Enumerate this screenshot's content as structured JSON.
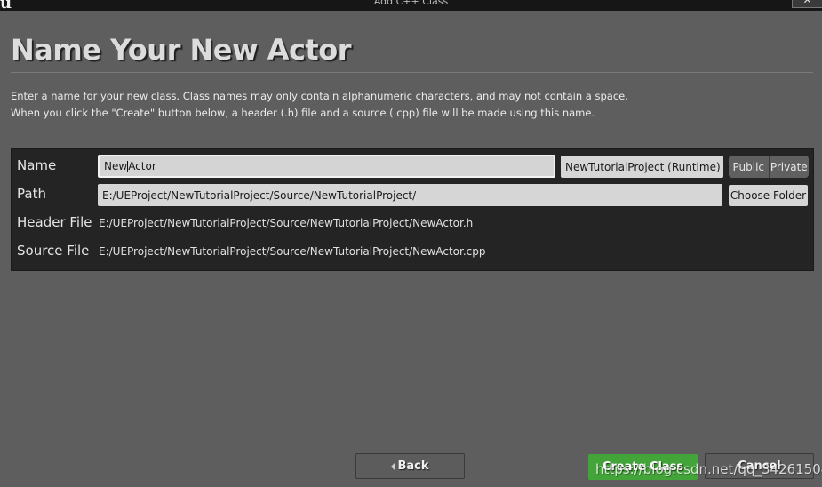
{
  "window": {
    "logo": "u",
    "title": "Add C++ Class",
    "close_label": "✕"
  },
  "page": {
    "heading": "Name Your New Actor",
    "description_line1": "Enter a name for your new class. Class names may only contain alphanumeric characters, and may not contain a space.",
    "description_line2": "When you click the \"Create\" button below, a header (.h) file and a source (.cpp) file will be made using this name."
  },
  "form": {
    "name": {
      "label": "Name",
      "value_before_caret": "New",
      "value_after_caret": "Actor"
    },
    "module_dropdown": {
      "value": "NewTutorialProject (Runtime)"
    },
    "visibility": {
      "options": [
        "Public",
        "Private"
      ]
    },
    "path": {
      "label": "Path",
      "value": "E:/UEProject/NewTutorialProject/Source/NewTutorialProject/"
    },
    "choose_folder_label": "Choose Folder",
    "header_file": {
      "label": "Header File",
      "value": "E:/UEProject/NewTutorialProject/Source/NewTutorialProject/NewActor.h"
    },
    "source_file": {
      "label": "Source File",
      "value": "E:/UEProject/NewTutorialProject/Source/NewTutorialProject/NewActor.cpp"
    }
  },
  "buttons": {
    "back": "Back",
    "create": "Create Class",
    "cancel": "Cancel"
  },
  "watermark": "https://blog.csdn.net/qq_34261504",
  "colors": {
    "background": "#5e5e5e",
    "panel": "#242424",
    "create_button": "#43a43a",
    "input": "#d6d6d6"
  }
}
